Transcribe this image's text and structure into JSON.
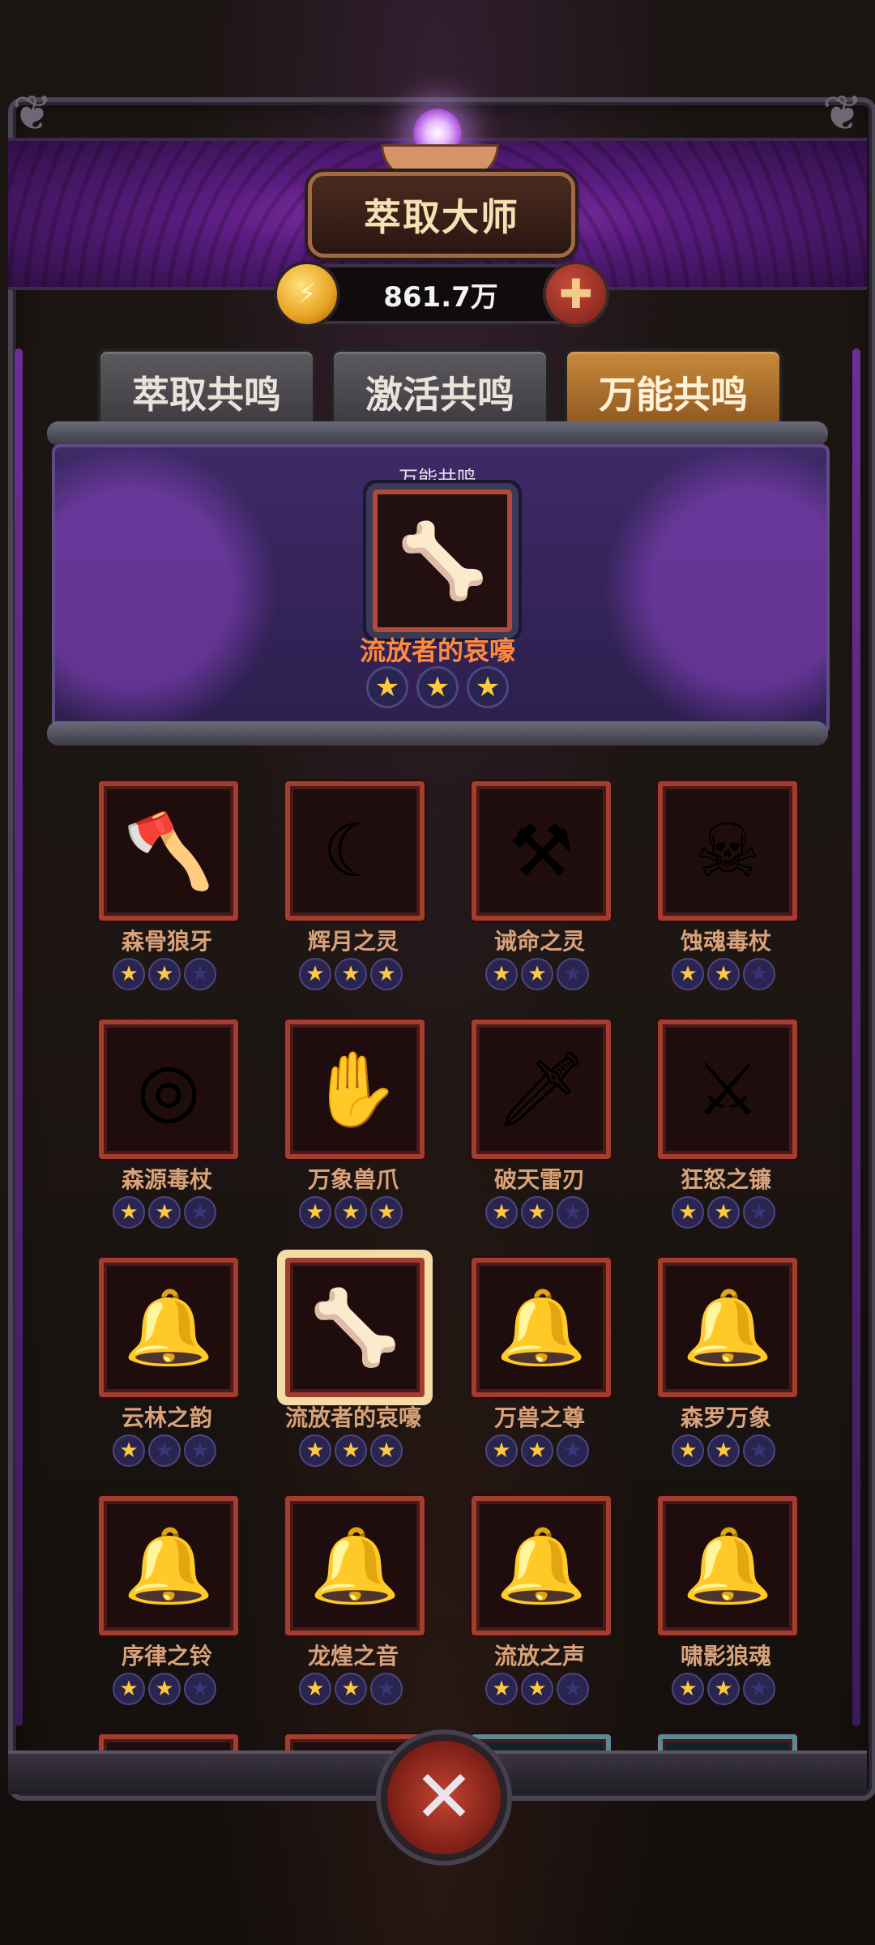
{
  "header": {
    "title": "萃取大师",
    "currency": "861.7万",
    "plus_symbol": "✚",
    "coin_symbol": "⚡"
  },
  "tabs": [
    {
      "label": "萃取共鸣",
      "active": false
    },
    {
      "label": "激活共鸣",
      "active": false
    },
    {
      "label": "万能共鸣",
      "active": true
    }
  ],
  "feature": {
    "label": "万能共鸣",
    "item_name": "流放者的哀嚎",
    "item_icon": "bone-staff-icon",
    "stars": 3
  },
  "items": [
    {
      "name": "森骨狼牙",
      "icon": "spiked-axe-icon",
      "glyph": "🪓",
      "stars": 2
    },
    {
      "name": "辉月之灵",
      "icon": "crescent-staff-icon",
      "glyph": "☾",
      "stars": 3
    },
    {
      "name": "诫命之灵",
      "icon": "mace-icon",
      "glyph": "⚒",
      "stars": 2
    },
    {
      "name": "蚀魂毒杖",
      "icon": "skull-staff-icon",
      "glyph": "☠",
      "stars": 2
    },
    {
      "name": "森源毒杖",
      "icon": "orb-staff-icon",
      "glyph": "◎",
      "stars": 2
    },
    {
      "name": "万象兽爪",
      "icon": "claw-staff-icon",
      "glyph": "✋",
      "stars": 3
    },
    {
      "name": "破天雷刃",
      "icon": "blade-icon",
      "glyph": "🗡",
      "stars": 2
    },
    {
      "name": "狂怒之镰",
      "icon": "scythe-icon",
      "glyph": "⚔",
      "stars": 2
    },
    {
      "name": "云林之韵",
      "icon": "moon-bell-icon",
      "glyph": "🔔",
      "stars": 1
    },
    {
      "name": "流放者的哀嚎",
      "icon": "bone-staff-icon",
      "glyph": "🦴",
      "stars": 3,
      "selected": true
    },
    {
      "name": "万兽之尊",
      "icon": "bell-icon",
      "glyph": "🔔",
      "stars": 2
    },
    {
      "name": "森罗万象",
      "icon": "bell-icon",
      "glyph": "🔔",
      "stars": 2
    },
    {
      "name": "序律之铃",
      "icon": "moon-bell-icon",
      "glyph": "🔔",
      "stars": 2
    },
    {
      "name": "龙煌之音",
      "icon": "bell-icon",
      "glyph": "🔔",
      "stars": 2
    },
    {
      "name": "流放之声",
      "icon": "bell-icon",
      "glyph": "🔔",
      "stars": 2
    },
    {
      "name": "啸影狼魂",
      "icon": "spear-bell-icon",
      "glyph": "🔔",
      "stars": 2
    }
  ],
  "colors": {
    "accent_orange": "#ff8a3c",
    "item_name": "#d9a27a",
    "slot_border": "#a23d30",
    "tab_active": "#c98a3a",
    "star": "#ffc93c"
  }
}
